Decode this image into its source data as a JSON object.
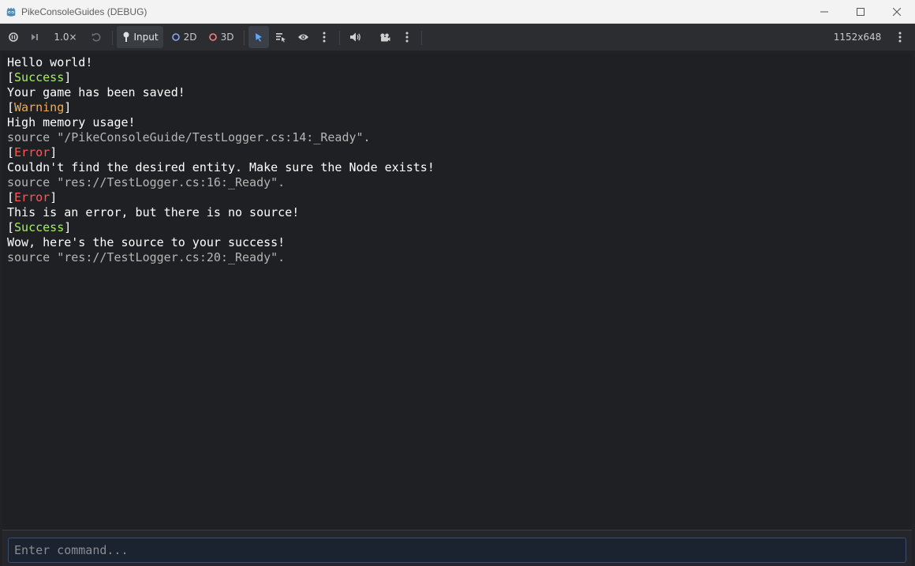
{
  "window": {
    "title": "PikeConsoleGuides (DEBUG)"
  },
  "toolbar": {
    "speed_label": "1.0×",
    "input_label": "Input",
    "mode_2d_label": "2D",
    "mode_3d_label": "3D",
    "resolution_label": "1152x648"
  },
  "console": {
    "line_0": "Hello world!",
    "line_1_tag": "Success",
    "line_2": "Your game has been saved!",
    "line_3_tag": "Warning",
    "line_4": "High memory usage!",
    "line_5_source": "source \"/PikeConsoleGuide/TestLogger.cs:14:_Ready\".",
    "line_6_tag": "Error",
    "line_7": "Couldn't find the desired entity. Make sure the Node exists!",
    "line_8_source": "source \"res://TestLogger.cs:16:_Ready\".",
    "line_9_tag": "Error",
    "line_10": "This is an error, but there is no source!",
    "line_11_tag": "Success",
    "line_12": "Wow, here's the source to your success!",
    "line_13_source": "source \"res://TestLogger.cs:20:_Ready\"."
  },
  "command": {
    "placeholder": "Enter command..."
  },
  "colors": {
    "success": "#a5ee62",
    "warning": "#f0ad52",
    "error": "#ff5757",
    "source": "#b5b5b5"
  }
}
